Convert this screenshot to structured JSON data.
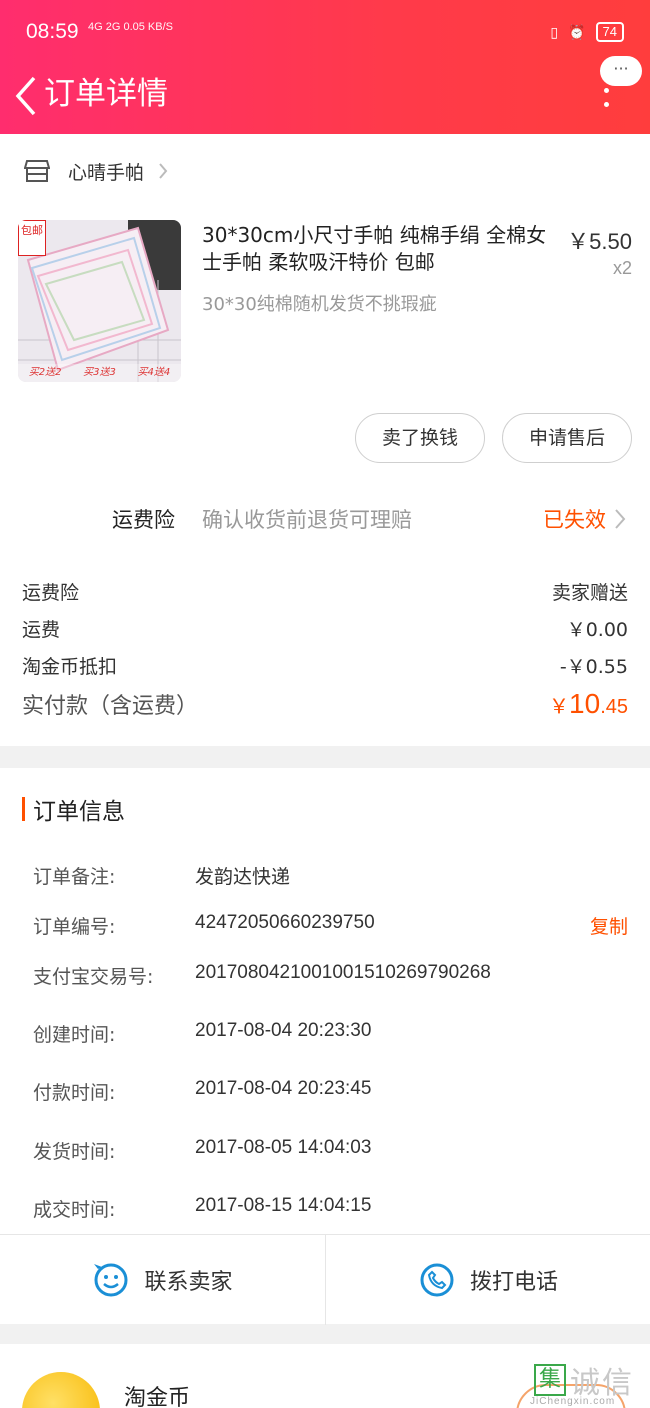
{
  "status_bar": {
    "time": "08:59",
    "network": "4G 2G",
    "speed": "0.05 KB/S",
    "battery": "74"
  },
  "nav": {
    "title": "订单详情",
    "more": "···"
  },
  "store": {
    "name": "心晴手帕"
  },
  "product": {
    "badge": "包邮",
    "image_tags": [
      "买2送2",
      "买3送3",
      "买4送4"
    ],
    "title": "30*30cm小尺寸手帕 纯棉手绢 全棉女士手帕 柔软吸汗特价 包邮",
    "spec": "30*30纯棉随机发货不挑瑕疵",
    "price": "￥5.50",
    "quantity": "x2",
    "buttons": {
      "sell": "卖了换钱",
      "after_sale": "申请售后"
    }
  },
  "insurance": {
    "label": "运费险",
    "desc": "确认收货前退货可理赔",
    "status": "已失效"
  },
  "summary": {
    "rows": [
      {
        "label": "运费险",
        "value": "卖家赠送"
      },
      {
        "label": "运费",
        "value": "￥0.00"
      },
      {
        "label": "淘金币抵扣",
        "value": "-￥0.55"
      }
    ],
    "total_label": "实付款（含运费）",
    "total_currency": "￥",
    "total_int": "10",
    "total_dec": ".45"
  },
  "order_info": {
    "title": "订单信息",
    "copy_label": "复制",
    "rows": [
      {
        "label": "订单备注:",
        "value": "发韵达快递"
      },
      {
        "label": "订单编号:",
        "value": "42472050660239750"
      },
      {
        "label": "支付宝交易号:",
        "value": "2017080421001001510269790268"
      },
      {
        "label": "创建时间:",
        "value": "2017-08-04 20:23:30"
      },
      {
        "label": "付款时间:",
        "value": "2017-08-04 20:23:45"
      },
      {
        "label": "发货时间:",
        "value": "2017-08-05 14:04:03"
      },
      {
        "label": "成交时间:",
        "value": "2017-08-15 14:04:15"
      }
    ]
  },
  "actions": {
    "contact": "联系卖家",
    "call": "拨打电话"
  },
  "coins": {
    "label": "淘金币"
  },
  "watermark": {
    "box": "集",
    "text": "诚信",
    "url": "JiChengxin.com"
  },
  "colors": {
    "accent": "#ff5000",
    "header_start": "#ff2d6e",
    "header_end": "#ff3d3d",
    "icon_blue": "#1a8fd6"
  }
}
